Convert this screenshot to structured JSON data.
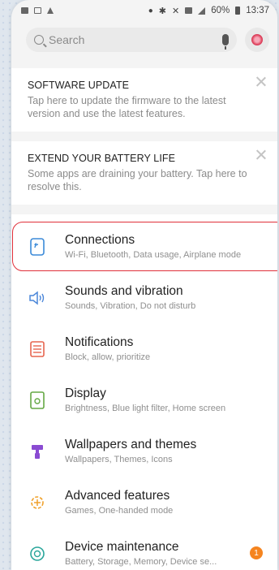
{
  "status_bar": {
    "time": "13:37",
    "battery": "60%"
  },
  "search": {
    "placeholder": "Search"
  },
  "cards": [
    {
      "title": "SOFTWARE UPDATE",
      "body": "Tap here to update the firmware to the latest version and use the latest features."
    },
    {
      "title": "EXTEND YOUR BATTERY LIFE",
      "body": "Some apps are draining your battery. Tap here to resolve this."
    }
  ],
  "settings": [
    {
      "title": "Connections",
      "subtitle": "Wi-Fi, Bluetooth, Data usage, Airplane mode",
      "icon": "connections-icon",
      "color": "#3b8ad8"
    },
    {
      "title": "Sounds and vibration",
      "subtitle": "Sounds, Vibration, Do not disturb",
      "icon": "speaker-icon",
      "color": "#4a86d9"
    },
    {
      "title": "Notifications",
      "subtitle": "Block, allow, prioritize",
      "icon": "notifications-icon",
      "color": "#e7654f"
    },
    {
      "title": "Display",
      "subtitle": "Brightness, Blue light filter, Home screen",
      "icon": "display-icon",
      "color": "#65a844"
    },
    {
      "title": "Wallpapers and themes",
      "subtitle": "Wallpapers, Themes, Icons",
      "icon": "brush-icon",
      "color": "#8a4bd2"
    },
    {
      "title": "Advanced features",
      "subtitle": "Games, One-handed mode",
      "icon": "gear-plus-icon",
      "color": "#f0a12a"
    },
    {
      "title": "Device maintenance",
      "subtitle": "Battery, Storage, Memory, Device se...",
      "icon": "maintenance-icon",
      "color": "#2aa69b",
      "badge": "1"
    }
  ],
  "colors": {
    "highlight": "#e0303a",
    "badge": "#f5841f"
  }
}
